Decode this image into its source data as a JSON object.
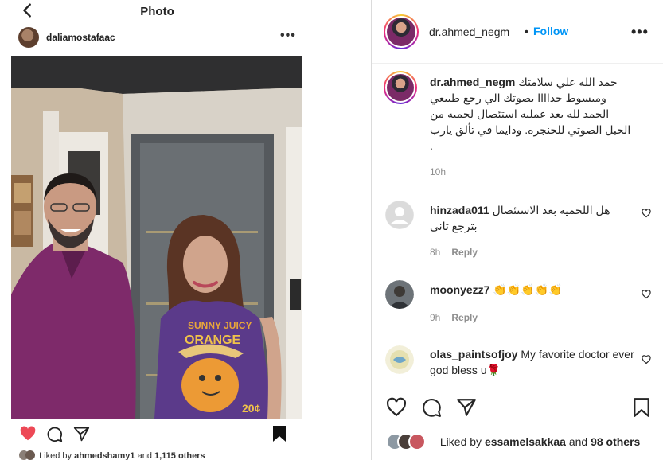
{
  "phone": {
    "title": "Photo",
    "username": "daliamostafaac",
    "liked_prefix": "Liked by ",
    "liked_user": "ahmedshamy1",
    "liked_and": " and ",
    "liked_others": "1,115 others"
  },
  "header": {
    "username": "dr.ahmed_negm",
    "separator": "•",
    "follow_label": "Follow"
  },
  "caption": {
    "username": "dr.ahmed_negm",
    "text": "حمد الله علي سلامتك ومبسوط جداااا بصوتك الي رجع طبيعي الحمد لله بعد عمليه استئصال لحميه من الحبل الصوتي للحنجره. ودايما في تألق يارب .",
    "time": "10h"
  },
  "comments": [
    {
      "username": "hinzada011",
      "text": "هل اللحمية بعد الاستئصال بترجع تانى",
      "time": "8h",
      "reply_label": "Reply"
    },
    {
      "username": "moonyezz7",
      "text": "👏👏👏👏👏",
      "time": "9h",
      "reply_label": "Reply"
    },
    {
      "username": "olas_paintsofjoy",
      "text": "My favorite doctor ever god bless u🌹",
      "time": "",
      "reply_label": ""
    }
  ],
  "likes": {
    "prefix": "Liked by ",
    "user": "essamelsakkaa",
    "and": " and ",
    "others": "98 others"
  },
  "colors": {
    "accent_blue": "#0095f6",
    "like_red": "#ed4956",
    "muted": "#8e8e8e",
    "text": "#262626"
  }
}
